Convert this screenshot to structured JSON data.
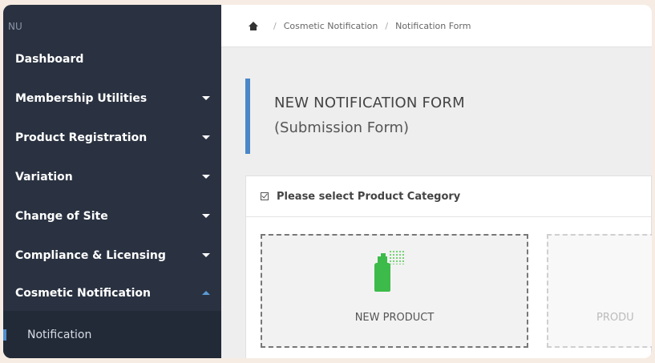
{
  "sidebar": {
    "menu_heading": "NU",
    "items": [
      {
        "label": "Dashboard"
      },
      {
        "label": "Membership Utilities"
      },
      {
        "label": "Product Registration"
      },
      {
        "label": "Variation"
      },
      {
        "label": "Change of Site"
      },
      {
        "label": "Compliance & Licensing"
      },
      {
        "label": "Cosmetic Notification"
      }
    ],
    "sub_item": {
      "label": "Notification"
    }
  },
  "breadcrumb": {
    "items": [
      "Cosmetic Notification",
      "Notification Form"
    ]
  },
  "page": {
    "title": "NEW NOTIFICATION FORM",
    "subtitle": "(Submission Form)"
  },
  "panel": {
    "header": "Please select Product Category",
    "cards": [
      {
        "label": "NEW PRODUCT",
        "icon": "spray-bottle-icon"
      },
      {
        "label": "PRODU"
      }
    ]
  },
  "colors": {
    "sidebar_bg": "#2a3241",
    "accent": "#4a86c8",
    "icon_green": "#3dbb4a"
  }
}
